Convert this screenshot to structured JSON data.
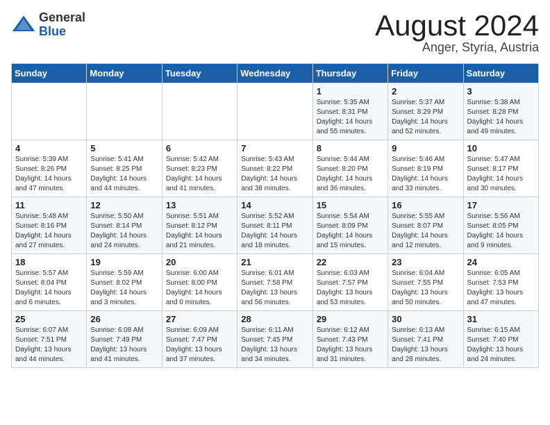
{
  "header": {
    "logo_general": "General",
    "logo_blue": "Blue",
    "title": "August 2024",
    "subtitle": "Anger, Styria, Austria"
  },
  "weekdays": [
    "Sunday",
    "Monday",
    "Tuesday",
    "Wednesday",
    "Thursday",
    "Friday",
    "Saturday"
  ],
  "weeks": [
    [
      {
        "day": "",
        "detail": ""
      },
      {
        "day": "",
        "detail": ""
      },
      {
        "day": "",
        "detail": ""
      },
      {
        "day": "",
        "detail": ""
      },
      {
        "day": "1",
        "detail": "Sunrise: 5:35 AM\nSunset: 8:31 PM\nDaylight: 14 hours\nand 55 minutes."
      },
      {
        "day": "2",
        "detail": "Sunrise: 5:37 AM\nSunset: 8:29 PM\nDaylight: 14 hours\nand 52 minutes."
      },
      {
        "day": "3",
        "detail": "Sunrise: 5:38 AM\nSunset: 8:28 PM\nDaylight: 14 hours\nand 49 minutes."
      }
    ],
    [
      {
        "day": "4",
        "detail": "Sunrise: 5:39 AM\nSunset: 8:26 PM\nDaylight: 14 hours\nand 47 minutes."
      },
      {
        "day": "5",
        "detail": "Sunrise: 5:41 AM\nSunset: 8:25 PM\nDaylight: 14 hours\nand 44 minutes."
      },
      {
        "day": "6",
        "detail": "Sunrise: 5:42 AM\nSunset: 8:23 PM\nDaylight: 14 hours\nand 41 minutes."
      },
      {
        "day": "7",
        "detail": "Sunrise: 5:43 AM\nSunset: 8:22 PM\nDaylight: 14 hours\nand 38 minutes."
      },
      {
        "day": "8",
        "detail": "Sunrise: 5:44 AM\nSunset: 8:20 PM\nDaylight: 14 hours\nand 36 minutes."
      },
      {
        "day": "9",
        "detail": "Sunrise: 5:46 AM\nSunset: 8:19 PM\nDaylight: 14 hours\nand 33 minutes."
      },
      {
        "day": "10",
        "detail": "Sunrise: 5:47 AM\nSunset: 8:17 PM\nDaylight: 14 hours\nand 30 minutes."
      }
    ],
    [
      {
        "day": "11",
        "detail": "Sunrise: 5:48 AM\nSunset: 8:16 PM\nDaylight: 14 hours\nand 27 minutes."
      },
      {
        "day": "12",
        "detail": "Sunrise: 5:50 AM\nSunset: 8:14 PM\nDaylight: 14 hours\nand 24 minutes."
      },
      {
        "day": "13",
        "detail": "Sunrise: 5:51 AM\nSunset: 8:12 PM\nDaylight: 14 hours\nand 21 minutes."
      },
      {
        "day": "14",
        "detail": "Sunrise: 5:52 AM\nSunset: 8:11 PM\nDaylight: 14 hours\nand 18 minutes."
      },
      {
        "day": "15",
        "detail": "Sunrise: 5:54 AM\nSunset: 8:09 PM\nDaylight: 14 hours\nand 15 minutes."
      },
      {
        "day": "16",
        "detail": "Sunrise: 5:55 AM\nSunset: 8:07 PM\nDaylight: 14 hours\nand 12 minutes."
      },
      {
        "day": "17",
        "detail": "Sunrise: 5:56 AM\nSunset: 8:05 PM\nDaylight: 14 hours\nand 9 minutes."
      }
    ],
    [
      {
        "day": "18",
        "detail": "Sunrise: 5:57 AM\nSunset: 8:04 PM\nDaylight: 14 hours\nand 6 minutes."
      },
      {
        "day": "19",
        "detail": "Sunrise: 5:59 AM\nSunset: 8:02 PM\nDaylight: 14 hours\nand 3 minutes."
      },
      {
        "day": "20",
        "detail": "Sunrise: 6:00 AM\nSunset: 8:00 PM\nDaylight: 14 hours and 0 minutes."
      },
      {
        "day": "21",
        "detail": "Sunrise: 6:01 AM\nSunset: 7:58 PM\nDaylight: 13 hours\nand 56 minutes."
      },
      {
        "day": "22",
        "detail": "Sunrise: 6:03 AM\nSunset: 7:57 PM\nDaylight: 13 hours\nand 53 minutes."
      },
      {
        "day": "23",
        "detail": "Sunrise: 6:04 AM\nSunset: 7:55 PM\nDaylight: 13 hours\nand 50 minutes."
      },
      {
        "day": "24",
        "detail": "Sunrise: 6:05 AM\nSunset: 7:53 PM\nDaylight: 13 hours\nand 47 minutes."
      }
    ],
    [
      {
        "day": "25",
        "detail": "Sunrise: 6:07 AM\nSunset: 7:51 PM\nDaylight: 13 hours\nand 44 minutes."
      },
      {
        "day": "26",
        "detail": "Sunrise: 6:08 AM\nSunset: 7:49 PM\nDaylight: 13 hours\nand 41 minutes."
      },
      {
        "day": "27",
        "detail": "Sunrise: 6:09 AM\nSunset: 7:47 PM\nDaylight: 13 hours\nand 37 minutes."
      },
      {
        "day": "28",
        "detail": "Sunrise: 6:11 AM\nSunset: 7:45 PM\nDaylight: 13 hours\nand 34 minutes."
      },
      {
        "day": "29",
        "detail": "Sunrise: 6:12 AM\nSunset: 7:43 PM\nDaylight: 13 hours\nand 31 minutes."
      },
      {
        "day": "30",
        "detail": "Sunrise: 6:13 AM\nSunset: 7:41 PM\nDaylight: 13 hours\nand 28 minutes."
      },
      {
        "day": "31",
        "detail": "Sunrise: 6:15 AM\nSunset: 7:40 PM\nDaylight: 13 hours\nand 24 minutes."
      }
    ]
  ]
}
